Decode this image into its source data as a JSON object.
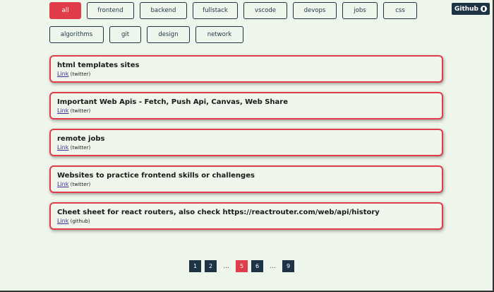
{
  "filters": {
    "row1": [
      "all",
      "frontend",
      "backend",
      "fullstack",
      "vscode",
      "devops",
      "jobs",
      "css"
    ],
    "row2": [
      "algorithms",
      "git",
      "design",
      "network"
    ],
    "active": "all"
  },
  "github": {
    "label": "Github"
  },
  "cards": [
    {
      "title": "html templates sites",
      "link": "Link",
      "source": "(twitter)"
    },
    {
      "title": "Important Web Apis - Fetch, Push Api, Canvas, Web Share",
      "link": "Link",
      "source": "(twitter)"
    },
    {
      "title": "remote jobs",
      "link": "Link",
      "source": "(twitter)"
    },
    {
      "title": "Websites to practice frontend skills or challenges",
      "link": "Link",
      "source": "(twitter)"
    },
    {
      "title": "Cheet sheet for react routers, also check https://reactrouter.com/web/api/history",
      "link": "Link",
      "source": "(github)"
    }
  ],
  "pagination": {
    "items": [
      "1",
      "2",
      "...",
      "5",
      "6",
      "...",
      "9"
    ],
    "current": "5"
  },
  "colors": {
    "accent": "#e03c4a",
    "navy": "#1f3347",
    "background": "#eef6ec"
  }
}
